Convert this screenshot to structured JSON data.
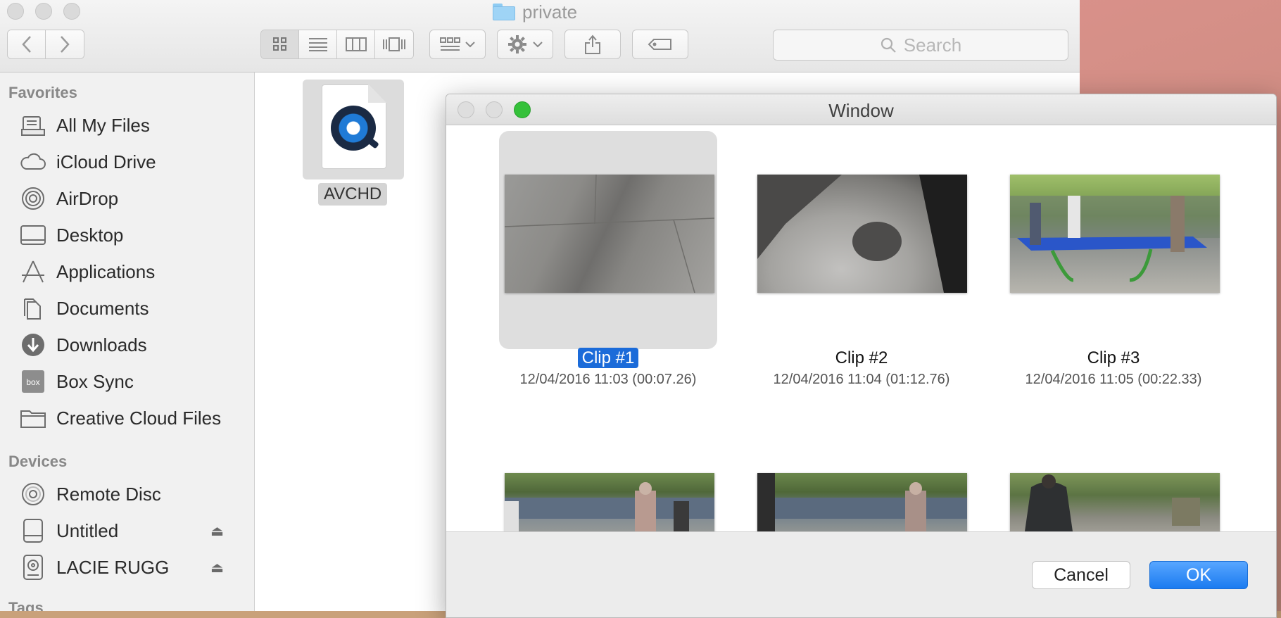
{
  "finder": {
    "title": "private",
    "search_placeholder": "Search",
    "favorites_header": "Favorites",
    "favorites": [
      {
        "label": "All My Files",
        "icon": "all-files-icon"
      },
      {
        "label": "iCloud Drive",
        "icon": "cloud-icon"
      },
      {
        "label": "AirDrop",
        "icon": "airdrop-icon"
      },
      {
        "label": "Desktop",
        "icon": "desktop-icon"
      },
      {
        "label": "Applications",
        "icon": "applications-icon"
      },
      {
        "label": "Documents",
        "icon": "documents-icon"
      },
      {
        "label": "Downloads",
        "icon": "downloads-icon"
      },
      {
        "label": "Box Sync",
        "icon": "box-icon"
      },
      {
        "label": "Creative Cloud Files",
        "icon": "folder-icon"
      }
    ],
    "devices_header": "Devices",
    "devices": [
      {
        "label": "Remote Disc",
        "icon": "disc-icon"
      },
      {
        "label": "Untitled",
        "icon": "drive-icon"
      },
      {
        "label": "LACIE RUGG",
        "icon": "external-drive-icon"
      }
    ],
    "tags_header": "Tags",
    "file": {
      "name": "AVCHD",
      "icon": "quicktime-icon"
    }
  },
  "dialog": {
    "title": "Window",
    "clips": [
      {
        "name": "Clip #1",
        "meta": "12/04/2016 11:03 (00:07.26)",
        "selected": true
      },
      {
        "name": "Clip #2",
        "meta": "12/04/2016 11:04 (01:12.76)",
        "selected": false
      },
      {
        "name": "Clip #3",
        "meta": "12/04/2016 11:05 (00:22.33)",
        "selected": false
      }
    ],
    "cancel_label": "Cancel",
    "ok_label": "OK"
  },
  "colors": {
    "selection": "#1b6bd9",
    "ok_button": "#1b7bf0",
    "zoom_light": "#35c13a"
  }
}
